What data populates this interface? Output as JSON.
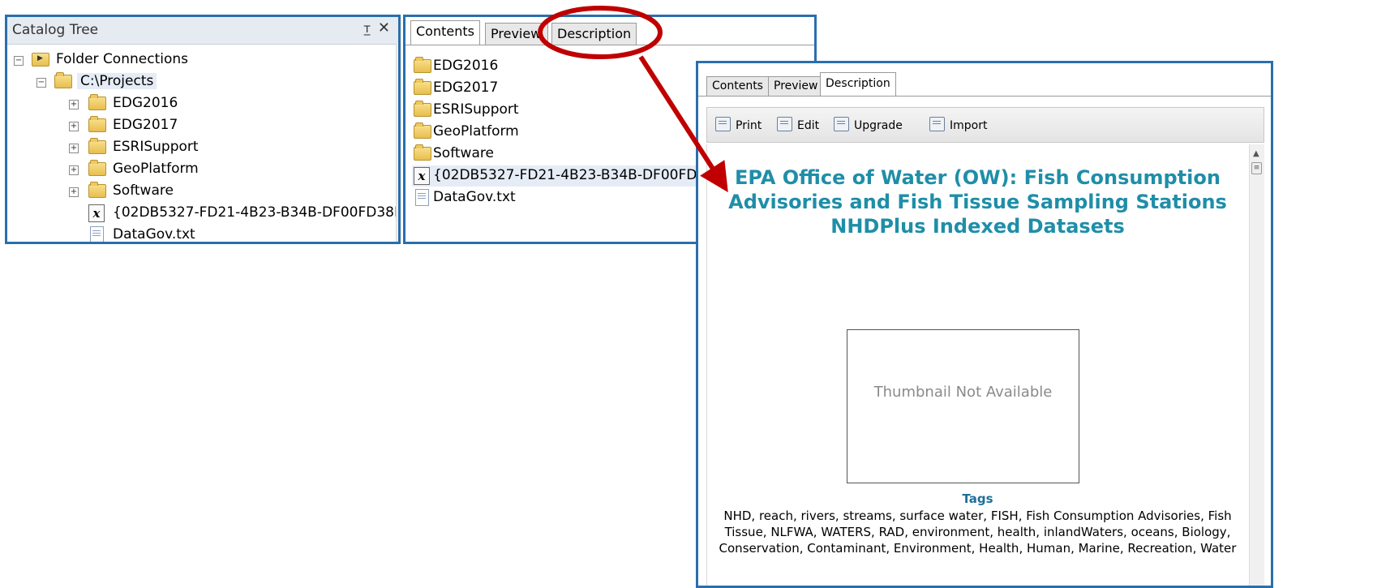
{
  "catalog_tree": {
    "title": "Catalog Tree",
    "pin_glyph": "ᴛ ",
    "close_glyph": "✕",
    "items": [
      {
        "label": "Folder Connections",
        "expander": "−",
        "icon": "folder-connection-icon"
      },
      {
        "label": "C:\\Projects",
        "expander": "−",
        "icon": "open-folder-icon"
      },
      {
        "label": "EDG2016",
        "expander": "+",
        "icon": "folder-icon"
      },
      {
        "label": "EDG2017",
        "expander": "+",
        "icon": "folder-icon"
      },
      {
        "label": "ESRISupport",
        "expander": "+",
        "icon": "folder-icon"
      },
      {
        "label": "GeoPlatform",
        "expander": "+",
        "icon": "folder-icon"
      },
      {
        "label": "Software",
        "expander": "+",
        "icon": "folder-icon"
      },
      {
        "label": "{02DB5327-FD21-4B23-B34B-DF00FD38E",
        "icon": "xml-file-icon"
      },
      {
        "label": "DataGov.txt",
        "icon": "text-file-icon"
      }
    ]
  },
  "contents_panel": {
    "tabs": [
      "Contents",
      "Preview",
      "Description"
    ],
    "active_tab": "Contents",
    "items": [
      {
        "label": "EDG2016",
        "icon": "folder-icon"
      },
      {
        "label": "EDG2017",
        "icon": "folder-icon"
      },
      {
        "label": "ESRISupport",
        "icon": "folder-icon"
      },
      {
        "label": "GeoPlatform",
        "icon": "folder-icon"
      },
      {
        "label": "Software",
        "icon": "folder-icon"
      },
      {
        "label": "{02DB5327-FD21-4B23-B34B-DF00FD",
        "icon": "xml-file-icon"
      },
      {
        "label": "DataGov.txt",
        "icon": "text-file-icon"
      }
    ]
  },
  "description_panel": {
    "tabs": [
      "Contents",
      "Preview",
      "Description"
    ],
    "active_tab": "Description",
    "toolbar": {
      "print": "Print",
      "edit": "Edit",
      "upgrade": "Upgrade",
      "import": "Import"
    },
    "title": "EPA Office of Water (OW): Fish Consumption Advisories and Fish Tissue Sampling Stations NHDPlus Indexed Datasets",
    "thumbnail_text": "Thumbnail Not Available",
    "tags_heading": "Tags",
    "tags": "NHD, reach, rivers, streams, surface water, FISH, Fish Consumption Advisories, Fish Tissue, NLFWA, WATERS, RAD, environment, health, inlandWaters, oceans, Biology, Conservation, Contaminant, Environment, Health, Human, Marine, Recreation, Water"
  },
  "colors": {
    "panel_border": "#2a6fad",
    "title_teal": "#1f8ea8",
    "callout_red": "#c00000"
  }
}
